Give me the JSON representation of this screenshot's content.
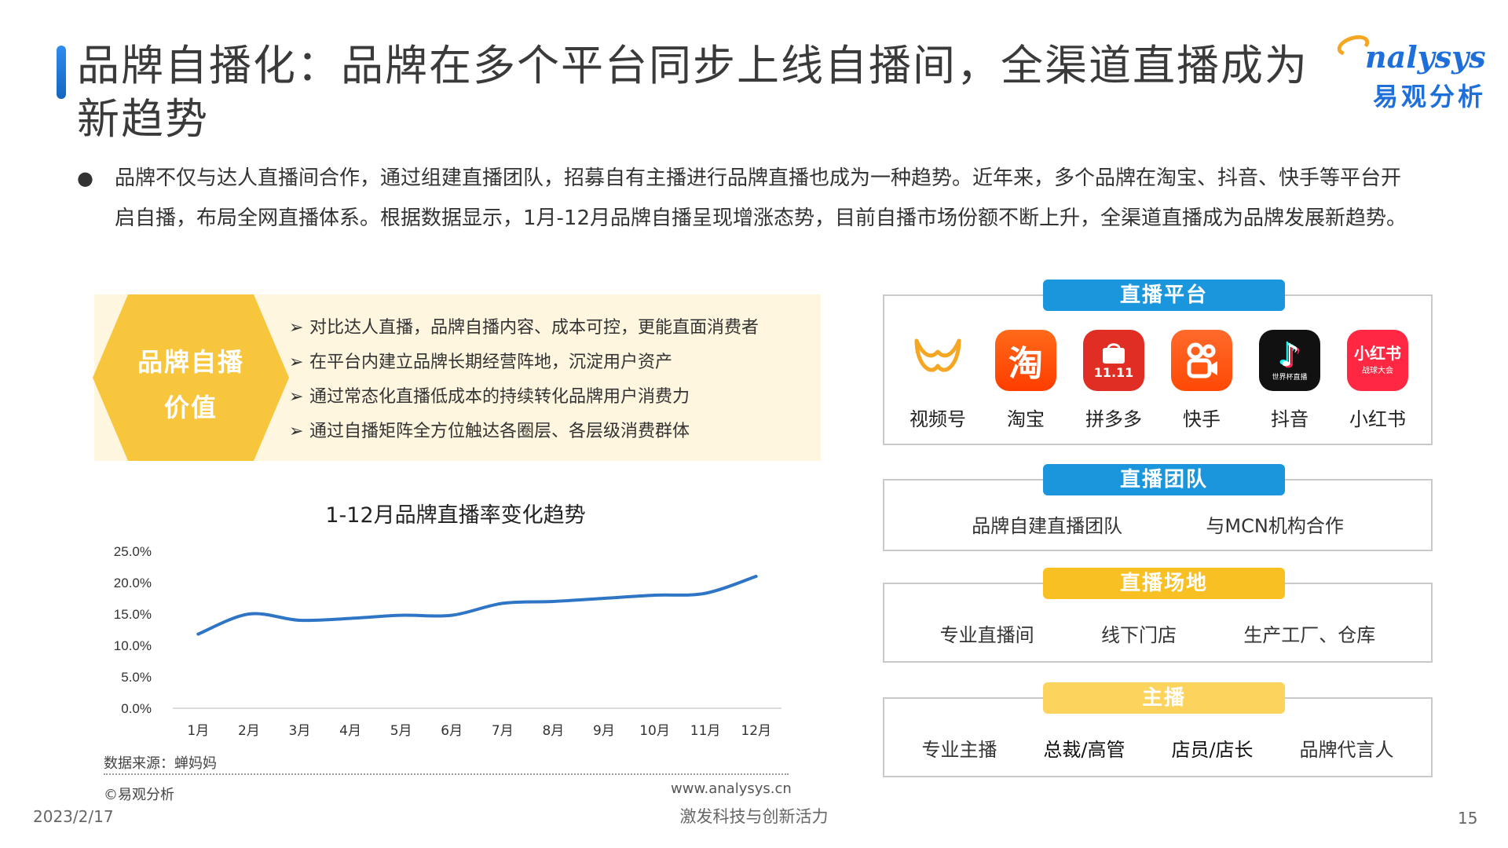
{
  "title": "品牌自播化：品牌在多个平台同步上线自播间，全渠道直播成为新趋势",
  "logo": {
    "en": "nalysys",
    "cn": "易观分析"
  },
  "intro": {
    "bullet": "●",
    "text": "品牌不仅与达人直播间合作，通过组建直播团队，招募自有主播进行品牌直播也成为一种趋势。近年来，多个品牌在淘宝、抖音、快手等平台开启自播，布局全网直播体系。根据数据显示，1月-12月品牌自播呈现增涨态势，目前自播市场份额不断上升，全渠道直播成为品牌发展新趋势。"
  },
  "value": {
    "label_line1": "品牌自播",
    "label_line2": "价值",
    "arrow": "➢",
    "items": [
      "对比达人直播，品牌自播内容、成本可控，更能直面消费者",
      "在平台内建立品牌长期经营阵地，沉淀用户资产",
      "通过常态化直播低成本的持续转化品牌用户消费力",
      "通过自播矩阵全方位触达各圈层、各层级消费群体"
    ]
  },
  "chart_data": {
    "type": "line",
    "title": "1-12月品牌直播率变化趋势",
    "categories": [
      "1月",
      "2月",
      "3月",
      "4月",
      "5月",
      "6月",
      "7月",
      "8月",
      "9月",
      "10月",
      "11月",
      "12月"
    ],
    "series": [
      {
        "values": [
          11.8,
          15.0,
          14.0,
          14.3,
          14.8,
          14.8,
          16.7,
          17.0,
          17.5,
          18.0,
          18.3,
          21.0
        ]
      }
    ],
    "yticks": [
      "0.0%",
      "5.0%",
      "10.0%",
      "15.0%",
      "20.0%",
      "25.0%"
    ],
    "ylim": [
      0,
      25
    ],
    "grid": false,
    "line_color": "#2e75c6"
  },
  "footer": {
    "source": "数据来源：蝉妈妈",
    "copyright": "©易观分析",
    "site": "www.analysys.cn",
    "slogan": "激发科技与创新活力",
    "date": "2023/2/17",
    "page": "15"
  },
  "platforms": {
    "header": "直播平台",
    "items": [
      {
        "label": "视频号",
        "icon": "wechat-channels-icon",
        "glyph": ""
      },
      {
        "label": "淘宝",
        "icon": "taobao-icon",
        "glyph": "淘"
      },
      {
        "label": "拼多多",
        "icon": "pinduoduo-icon",
        "glyph": "11.11"
      },
      {
        "label": "快手",
        "icon": "kuaishou-icon",
        "glyph": ""
      },
      {
        "label": "抖音",
        "icon": "douyin-icon",
        "glyph": "♪",
        "subtext": "世界杯直播"
      },
      {
        "label": "小红书",
        "icon": "xiaohongshu-icon",
        "glyph": "小红书",
        "subtext": "战球大会"
      }
    ]
  },
  "team": {
    "header": "直播团队",
    "items": [
      "品牌自建直播团队",
      "与MCN机构合作"
    ]
  },
  "venue": {
    "header": "直播场地",
    "items": [
      "专业直播间",
      "线下门店",
      "生产工厂、仓库"
    ]
  },
  "host": {
    "header": "主播",
    "items": [
      "专业主播",
      "总裁/高管",
      "店员/店长",
      "品牌代言人"
    ]
  },
  "colors": {
    "accent_blue": "#1a96dc",
    "accent_yellow": "#f8c022",
    "hexagon": "#f8c63c"
  }
}
